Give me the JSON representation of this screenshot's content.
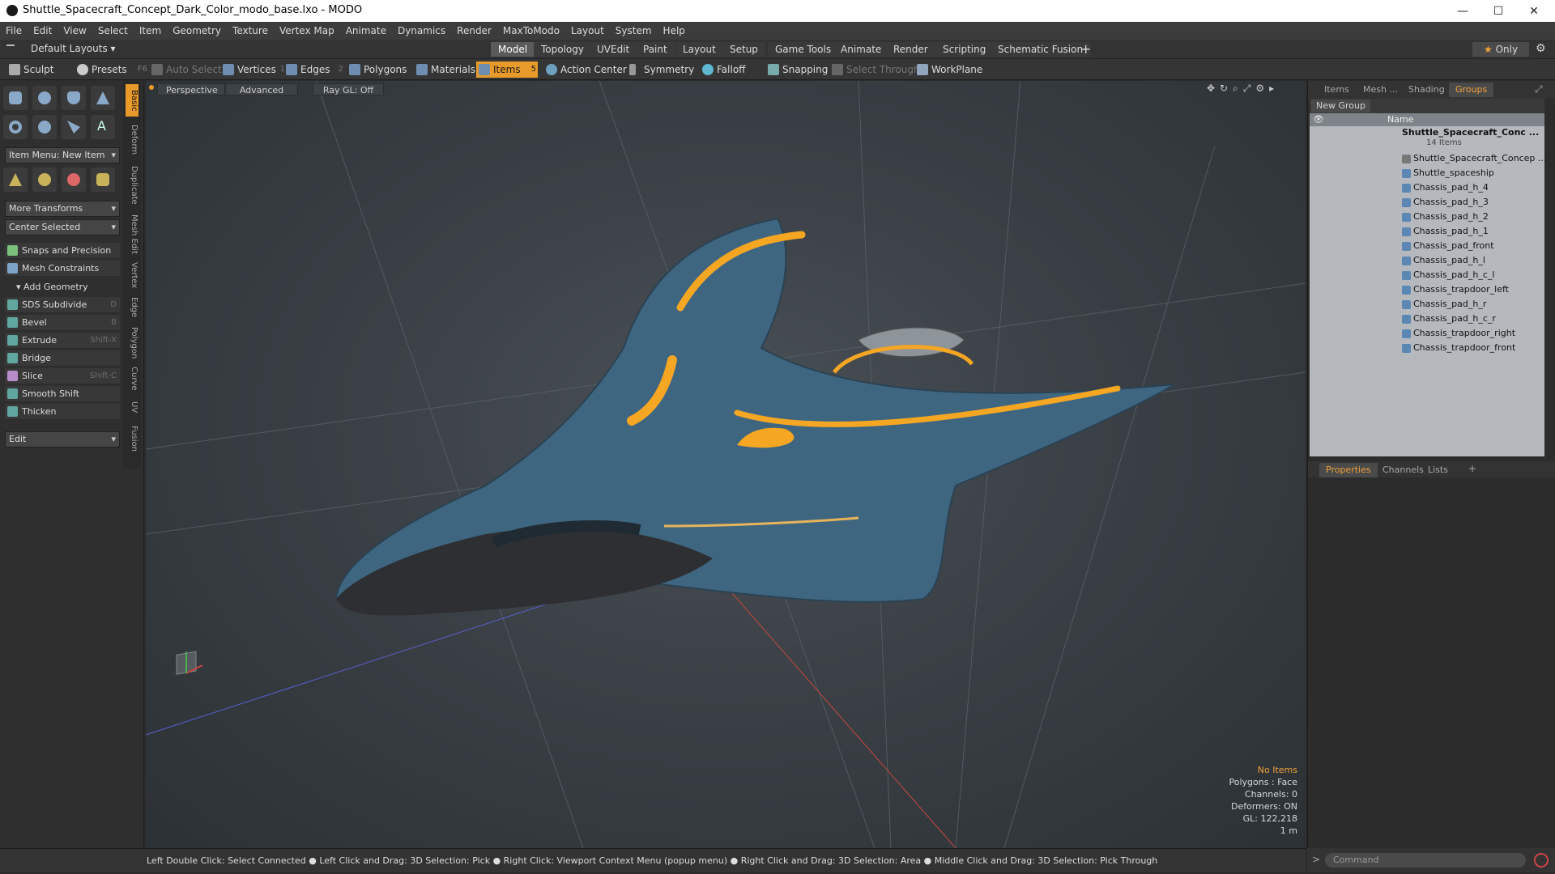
{
  "window": {
    "title": "Shuttle_Spacecraft_Concept_Dark_Color_modo_base.lxo - MODO"
  },
  "menu": [
    "File",
    "Edit",
    "View",
    "Select",
    "Item",
    "Geometry",
    "Texture",
    "Vertex Map",
    "Animate",
    "Dynamics",
    "Render",
    "MaxToModo",
    "Layout",
    "System",
    "Help"
  ],
  "layout": {
    "preset": "Default Layouts",
    "tabs": [
      "Model",
      "Topology",
      "UVEdit",
      "Paint",
      "Layout",
      "Setup",
      "Game Tools",
      "Animate",
      "Render",
      "Scripting",
      "Schematic Fusion"
    ],
    "active_tab": "Model",
    "only_label": "Only"
  },
  "toolbar": {
    "sculpt": "Sculpt",
    "presets": "Presets",
    "presets_key": "F6",
    "auto_select": "Auto Select",
    "vertices": "Vertices",
    "vertices_count": "1",
    "edges": "Edges",
    "edges_count": "2",
    "polygons": "Polygons",
    "materials": "Materials",
    "items": "Items",
    "items_count": "5",
    "action_center": "Action Center",
    "symmetry": "Symmetry",
    "falloff": "Falloff",
    "snapping": "Snapping",
    "select_through": "Select Through",
    "workplane": "WorkPlane"
  },
  "left_panel": {
    "item_menu": "Item Menu: New Item",
    "more_transforms": "More Transforms",
    "center_selected": "Center Selected",
    "snaps": "Snaps and Precision",
    "mesh_constraints": "Mesh Constraints",
    "add_geometry": "Add Geometry",
    "tools": [
      {
        "label": "SDS Subdivide",
        "key": "D"
      },
      {
        "label": "Bevel",
        "key": "B"
      },
      {
        "label": "Extrude",
        "key": "Shift-X"
      },
      {
        "label": "Bridge",
        "key": ""
      },
      {
        "label": "Slice",
        "key": "Shift-C"
      },
      {
        "label": "Smooth Shift",
        "key": ""
      },
      {
        "label": "Thicken",
        "key": ""
      }
    ],
    "edit": "Edit",
    "vertical_tabs": [
      "Basic",
      "Deform",
      "Duplicate",
      "Mesh Edit",
      "Vertex",
      "Edge",
      "Polygon",
      "Curve",
      "UV",
      "Fusion"
    ]
  },
  "viewport": {
    "view": "Perspective",
    "advanced": "Advanced",
    "raygl": "Ray GL: Off",
    "hud": {
      "selection": "No Items",
      "polygons": "Polygons : Face",
      "channels": "Channels: 0",
      "deformers": "Deformers: ON",
      "gl": "GL: 122,218",
      "scale": "1 m"
    }
  },
  "right_panel": {
    "tabs": [
      "Items",
      "Mesh ...",
      "Shading",
      "Groups"
    ],
    "active_tab": "Groups",
    "new_group": "New Group",
    "name_header": "Name",
    "root": "Shuttle_Spacecraft_Conc ...",
    "root_count": "14 Items",
    "items": [
      "Shuttle_Spacecraft_Concep ...",
      "Shuttle_spaceship",
      "Chassis_pad_h_4",
      "Chassis_pad_h_3",
      "Chassis_pad_h_2",
      "Chassis_pad_h_1",
      "Chassis_pad_front",
      "Chassis_pad_h_l",
      "Chassis_pad_h_c_l",
      "Chassis_trapdoor_left",
      "Chassis_pad_h_r",
      "Chassis_pad_h_c_r",
      "Chassis_trapdoor_right",
      "Chassis_trapdoor_front"
    ],
    "bottom_tabs": [
      "Properties",
      "Channels",
      "Lists"
    ],
    "bottom_active": "Properties"
  },
  "status": {
    "hint": "Left Double Click: Select Connected ● Left Click and Drag: 3D Selection: Pick ● Right Click: Viewport Context Menu (popup menu) ● Right Click and Drag: 3D Selection: Area ● Middle Click and Drag: 3D Selection: Pick Through",
    "command_placeholder": "Command"
  },
  "colors": {
    "accent": "#e89b2a",
    "hull": "#3f6680",
    "trim": "#f5a623"
  }
}
